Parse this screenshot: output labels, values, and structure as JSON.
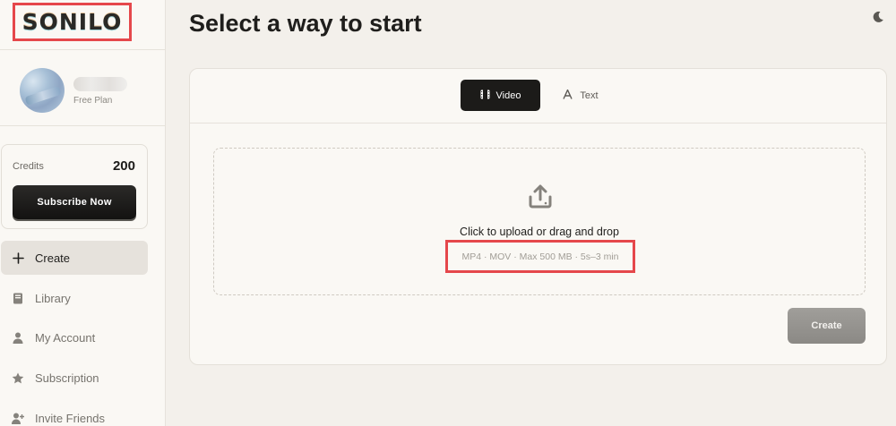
{
  "brand": {
    "logo_text": "SONILO"
  },
  "user": {
    "plan": "Free Plan"
  },
  "credits": {
    "label": "Credits",
    "value": "200",
    "subscribe_label": "Subscribe Now"
  },
  "nav": {
    "items": [
      {
        "label": "Create",
        "icon": "plus-icon",
        "active": true
      },
      {
        "label": "Library",
        "icon": "book-icon",
        "active": false
      },
      {
        "label": "My Account",
        "icon": "person-icon",
        "active": false
      },
      {
        "label": "Subscription",
        "icon": "star-icon",
        "active": false
      },
      {
        "label": "Invite Friends",
        "icon": "person-add-icon",
        "active": false
      }
    ]
  },
  "header": {
    "title": "Select a way to start",
    "theme_icon": "moon-icon"
  },
  "tabs": [
    {
      "label": "Video",
      "icon": "film-icon",
      "active": true
    },
    {
      "label": "Text",
      "icon": "text-icon",
      "active": false
    }
  ],
  "upload": {
    "icon": "upload-icon",
    "title": "Click to upload or drag and drop",
    "formats": "MP4 · MOV · Max 500 MB · 5s–3 min"
  },
  "actions": {
    "create_label": "Create"
  },
  "colors": {
    "accent_dark": "#1c1b19",
    "highlight_red": "#e5474b",
    "background": "#f3f0eb"
  }
}
